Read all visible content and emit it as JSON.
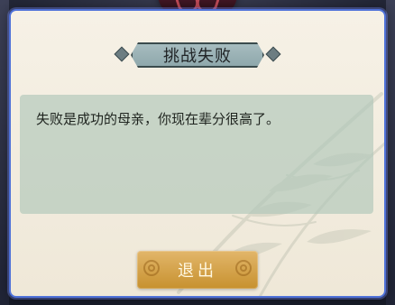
{
  "dialog": {
    "title": "挑战失败",
    "message": "失败是成功的母亲，你现在辈分很高了。",
    "exit_button_label": "退出"
  }
}
